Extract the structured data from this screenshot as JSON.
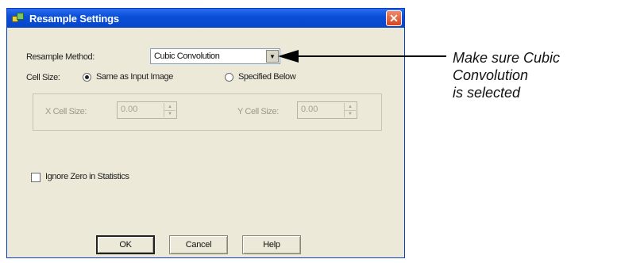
{
  "window": {
    "title": "Resample Settings",
    "close_glyph": "✕"
  },
  "resample": {
    "label": "Resample Method:",
    "value": "Cubic Convolution",
    "dropdown_glyph": "▼"
  },
  "cell_size": {
    "label": "Cell Size:",
    "option_same": "Same as Input Image",
    "option_specified": "Specified Below",
    "selected": "Same as Input Image",
    "x_label": "X Cell Size:",
    "x_value": "0.00",
    "y_label": "Y Cell Size:",
    "y_value": "0.00",
    "spin_up_glyph": "▲",
    "spin_down_glyph": "▼"
  },
  "ignore_zero": {
    "label": "Ignore Zero in Statistics",
    "checked": false
  },
  "buttons": {
    "ok": "OK",
    "cancel": "Cancel",
    "help": "Help"
  },
  "annotation": {
    "line1": "Make sure Cubic",
    "line2": "Convolution",
    "line3": "is selected"
  },
  "colors": {
    "titlebar": "#0a4fd8",
    "dialog_bg": "#ece9d8",
    "close_button": "#d8431e",
    "disabled_text": "#9a9888"
  }
}
